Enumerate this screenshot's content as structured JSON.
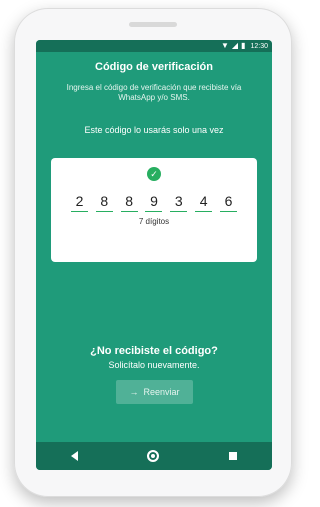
{
  "status_bar": {
    "time": "12:30",
    "icons": [
      "wifi-icon",
      "signal-icon",
      "battery-icon"
    ]
  },
  "screen": {
    "title": "Código de verificación",
    "subtitle": "Ingresa el código de verificación que recibiste vía WhatsApp y/o SMS.",
    "info": "Este código lo usarás solo una vez"
  },
  "code_card": {
    "digits": [
      "2",
      "8",
      "8",
      "9",
      "3",
      "4",
      "6"
    ],
    "digit_count_label": "7 dígitos",
    "accent_color": "#27ae60"
  },
  "resend_section": {
    "question": "¿No recibiste el código?",
    "request_text": "Solicítalo nuevamente.",
    "button_label": "Reenviar"
  },
  "nav_bar": {
    "buttons": [
      "back-icon",
      "home-icon",
      "recents-icon"
    ]
  },
  "colors": {
    "background": "#1f9b7a",
    "status_bar": "#156f58"
  }
}
